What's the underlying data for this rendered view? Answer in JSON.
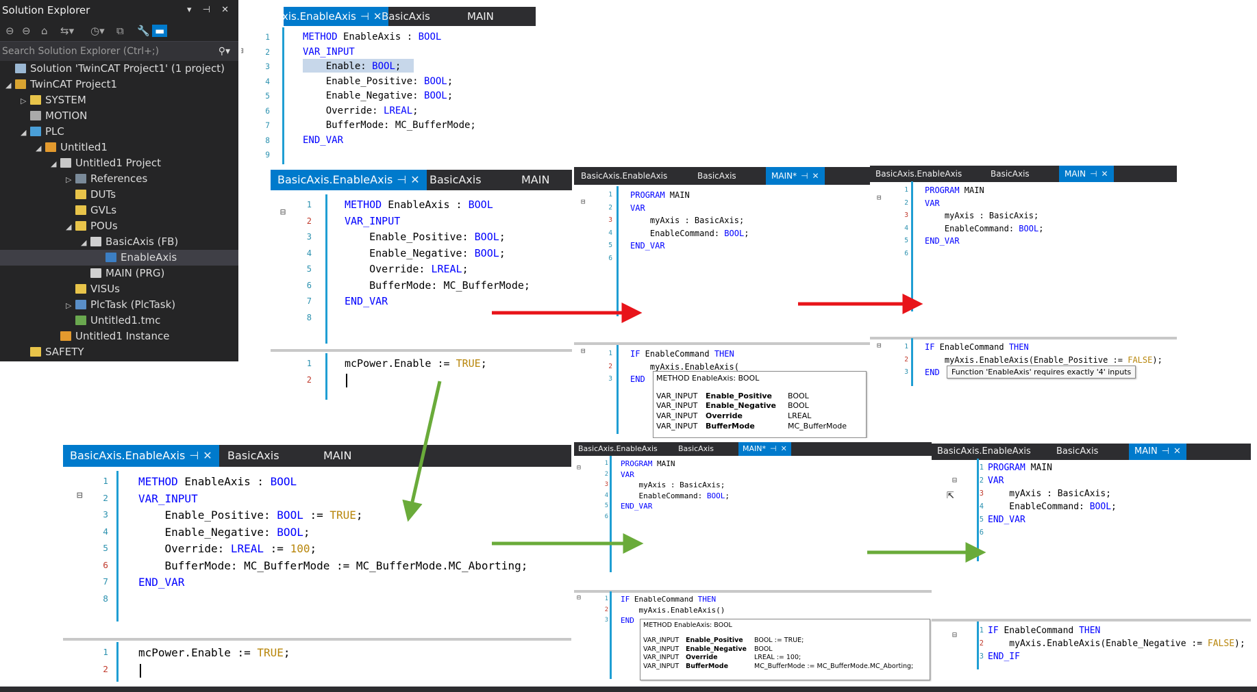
{
  "solution_explorer": {
    "title": "Solution Explorer",
    "header_controls": "▾ ⊣ ✕",
    "search_placeholder": "Search Solution Explorer (Ctrl+;)",
    "toolbar_icons": [
      "back-icon",
      "forward-icon",
      "home-icon",
      "sync-icon",
      "history-icon",
      "collapse-icon",
      "properties-icon",
      "preview-icon"
    ],
    "items": [
      {
        "label": "Solution 'TwinCAT Project1' (1 project)",
        "level": 0,
        "exp": "",
        "icon": "#9bb8d3"
      },
      {
        "label": "TwinCAT Project1",
        "level": 0,
        "exp": "◢",
        "icon": "#d9a431"
      },
      {
        "label": "SYSTEM",
        "level": 1,
        "exp": "▷",
        "icon": "#e8c44a"
      },
      {
        "label": "MOTION",
        "level": 1,
        "exp": "",
        "icon": "#aaaaaa"
      },
      {
        "label": "PLC",
        "level": 1,
        "exp": "◢",
        "icon": "#4a9fd8"
      },
      {
        "label": "Untitled1",
        "level": 2,
        "exp": "◢",
        "icon": "#e39a2e"
      },
      {
        "label": "Untitled1 Project",
        "level": 3,
        "exp": "◢",
        "icon": "#c8c8c8"
      },
      {
        "label": "References",
        "level": 4,
        "exp": "▷",
        "icon": "#7a8a99"
      },
      {
        "label": "DUTs",
        "level": 4,
        "exp": "",
        "icon": "#e8c44a"
      },
      {
        "label": "GVLs",
        "level": 4,
        "exp": "",
        "icon": "#e8c44a"
      },
      {
        "label": "POUs",
        "level": 4,
        "exp": "◢",
        "icon": "#e8c44a"
      },
      {
        "label": "BasicAxis (FB)",
        "level": 5,
        "exp": "◢",
        "icon": "#d0d0d0"
      },
      {
        "label": "EnableAxis",
        "level": 6,
        "exp": "",
        "icon": "#3c7fc4",
        "selected": true
      },
      {
        "label": "MAIN (PRG)",
        "level": 5,
        "exp": "",
        "icon": "#d0d0d0"
      },
      {
        "label": "VISUs",
        "level": 4,
        "exp": "",
        "icon": "#e8c44a"
      },
      {
        "label": "PlcTask (PlcTask)",
        "level": 4,
        "exp": "▷",
        "icon": "#5a8fc8"
      },
      {
        "label": "Untitled1.tmc",
        "level": 4,
        "exp": "",
        "icon": "#6aa84f"
      },
      {
        "label": "Untitled1 Instance",
        "level": 3,
        "exp": "",
        "icon": "#e39a2e"
      },
      {
        "label": "SAFETY",
        "level": 1,
        "exp": "",
        "icon": "#e8c44a"
      }
    ]
  },
  "tab_labels": {
    "method": "BasicAxis.EnableAxis",
    "fb": "BasicAxis",
    "main": "MAIN",
    "main_mod": "MAIN*",
    "pin": "⊣",
    "close": "✕"
  },
  "editors": [
    {
      "id": "e1",
      "lines_decl": [
        [
          [
            "kw",
            "METHOD"
          ],
          [
            "",
            " EnableAxis : "
          ],
          [
            "kw",
            "BOOL"
          ]
        ],
        [
          [
            "kw",
            "VAR_INPUT"
          ]
        ],
        [
          [
            "",
            "    Enable: "
          ],
          [
            "tp",
            "BOOL"
          ],
          [
            "",
            ";"
          ]
        ],
        [
          [
            "",
            "    Enable_Positive: "
          ],
          [
            "tp",
            "BOOL"
          ],
          [
            "",
            ";"
          ]
        ],
        [
          [
            "",
            "    Enable_Negative: "
          ],
          [
            "tp",
            "BOOL"
          ],
          [
            "",
            ";"
          ]
        ],
        [
          [
            "",
            "    Override: "
          ],
          [
            "tp",
            "LREAL"
          ],
          [
            "",
            ";"
          ]
        ],
        [
          [
            "",
            "    BufferMode: MC_BufferMode;"
          ]
        ],
        [
          [
            "kw",
            "END_VAR"
          ]
        ],
        []
      ]
    },
    {
      "id": "e2",
      "lines_decl": [
        [
          [
            "kw",
            "METHOD"
          ],
          [
            "",
            " EnableAxis : "
          ],
          [
            "kw",
            "BOOL"
          ]
        ],
        [
          [
            "kw",
            "VAR_INPUT"
          ]
        ],
        [
          [
            "",
            "    Enable_Positive: "
          ],
          [
            "tp",
            "BOOL"
          ],
          [
            "",
            ";"
          ]
        ],
        [
          [
            "",
            "    Enable_Negative: "
          ],
          [
            "tp",
            "BOOL"
          ],
          [
            "",
            ";"
          ]
        ],
        [
          [
            "",
            "    Override: "
          ],
          [
            "tp",
            "LREAL"
          ],
          [
            "",
            ";"
          ]
        ],
        [
          [
            "",
            "    BufferMode: MC_BufferMode;"
          ]
        ],
        [
          [
            "kw",
            "END_VAR"
          ]
        ],
        []
      ],
      "lines_impl": [
        [
          [
            "",
            "mcPower.Enable := "
          ],
          [
            "lit",
            "TRUE"
          ],
          [
            "",
            ";"
          ]
        ],
        []
      ]
    },
    {
      "id": "e3",
      "lines_decl": [
        [
          [
            "kw",
            "PROGRAM"
          ],
          [
            "",
            " MAIN"
          ]
        ],
        [
          [
            "kw",
            "VAR"
          ]
        ],
        [
          [
            "",
            "    myAxis : BasicAxis;"
          ]
        ],
        [
          [
            "",
            "    EnableCommand: "
          ],
          [
            "tp",
            "BOOL"
          ],
          [
            "",
            ";"
          ]
        ],
        [
          [
            "kw",
            "END_VAR"
          ]
        ],
        []
      ],
      "lines_impl": [
        [
          [
            "kw",
            "IF"
          ],
          [
            "",
            " EnableCommand "
          ],
          [
            "kw",
            "THEN"
          ]
        ],
        [
          [
            "",
            "    myAxis.EnableAxis("
          ]
        ],
        [
          [
            "kw",
            "END"
          ]
        ]
      ]
    },
    {
      "id": "e4",
      "lines_decl": [
        [
          [
            "kw",
            "PROGRAM"
          ],
          [
            "",
            " MAIN"
          ]
        ],
        [
          [
            "kw",
            "VAR"
          ]
        ],
        [
          [
            "",
            "    myAxis : BasicAxis;"
          ]
        ],
        [
          [
            "",
            "    EnableCommand: "
          ],
          [
            "tp",
            "BOOL"
          ],
          [
            "",
            ";"
          ]
        ],
        [
          [
            "kw",
            "END_VAR"
          ]
        ],
        []
      ],
      "lines_impl": [
        [
          [
            "kw",
            "IF"
          ],
          [
            "",
            " EnableCommand "
          ],
          [
            "kw",
            "THEN"
          ]
        ],
        [
          [
            "",
            "    myAxis.EnableAxis(Enable_Positive := "
          ],
          [
            "lit",
            "FALSE"
          ],
          [
            "",
            ");"
          ]
        ],
        [
          [
            "kw",
            "END"
          ]
        ]
      ]
    },
    {
      "id": "e5",
      "lines_decl": [
        [
          [
            "kw",
            "METHOD"
          ],
          [
            "",
            " EnableAxis : "
          ],
          [
            "kw",
            "BOOL"
          ]
        ],
        [
          [
            "kw",
            "VAR_INPUT"
          ]
        ],
        [
          [
            "",
            "    Enable_Positive: "
          ],
          [
            "tp",
            "BOOL"
          ],
          [
            "",
            " := "
          ],
          [
            "lit",
            "TRUE"
          ],
          [
            "",
            ";"
          ]
        ],
        [
          [
            "",
            "    Enable_Negative: "
          ],
          [
            "tp",
            "BOOL"
          ],
          [
            "",
            ";"
          ]
        ],
        [
          [
            "",
            "    Override: "
          ],
          [
            "tp",
            "LREAL"
          ],
          [
            "",
            " := "
          ],
          [
            "lit",
            "100"
          ],
          [
            "",
            ";"
          ]
        ],
        [
          [
            "",
            "    BufferMode: MC_BufferMode := MC_BufferMode.MC_Aborting;"
          ]
        ],
        [
          [
            "kw",
            "END_VAR"
          ]
        ],
        []
      ],
      "lines_impl": [
        [
          [
            "",
            "mcPower.Enable := "
          ],
          [
            "lit",
            "TRUE"
          ],
          [
            "",
            ";"
          ]
        ],
        []
      ]
    },
    {
      "id": "e6",
      "lines_decl": [
        [
          [
            "kw",
            "PROGRAM"
          ],
          [
            "",
            " MAIN"
          ]
        ],
        [
          [
            "kw",
            "VAR"
          ]
        ],
        [
          [
            "",
            "    myAxis : BasicAxis;"
          ]
        ],
        [
          [
            "",
            "    EnableCommand: "
          ],
          [
            "tp",
            "BOOL"
          ],
          [
            "",
            ";"
          ]
        ],
        [
          [
            "kw",
            "END_VAR"
          ]
        ],
        []
      ],
      "lines_impl": [
        [
          [
            "kw",
            "IF"
          ],
          [
            "",
            " EnableCommand "
          ],
          [
            "kw",
            "THEN"
          ]
        ],
        [
          [
            "",
            "    myAxis.EnableAxis()"
          ]
        ],
        [
          [
            "kw",
            "END"
          ]
        ]
      ]
    },
    {
      "id": "e7",
      "lines_decl": [
        [
          [
            "kw",
            "PROGRAM"
          ],
          [
            "",
            " MAIN"
          ]
        ],
        [
          [
            "kw",
            "VAR"
          ]
        ],
        [
          [
            "",
            "    myAxis : BasicAxis;"
          ]
        ],
        [
          [
            "",
            "    EnableCommand: "
          ],
          [
            "tp",
            "BOOL"
          ],
          [
            "",
            ";"
          ]
        ],
        [
          [
            "kw",
            "END_VAR"
          ]
        ],
        []
      ],
      "lines_impl": [
        [
          [
            "kw",
            "IF"
          ],
          [
            "",
            " EnableCommand "
          ],
          [
            "kw",
            "THEN"
          ]
        ],
        [
          [
            "",
            "    myAxis.EnableAxis(Enable_Negative := "
          ],
          [
            "lit",
            "FALSE"
          ],
          [
            "",
            ");"
          ]
        ],
        [
          [
            "kw",
            "END_IF"
          ]
        ]
      ]
    }
  ],
  "tooltips": {
    "e3": {
      "title": "METHOD EnableAxis: BOOL",
      "rows": [
        [
          "VAR_INPUT",
          "Enable_Positive",
          "BOOL"
        ],
        [
          "VAR_INPUT",
          "Enable_Negative",
          "BOOL"
        ],
        [
          "VAR_INPUT",
          "Override",
          "LREAL"
        ],
        [
          "VAR_INPUT",
          "BufferMode",
          "MC_BufferMode"
        ]
      ]
    },
    "e4": {
      "text": "Function 'EnableAxis' requires exactly '4' inputs"
    },
    "e6": {
      "title": "METHOD EnableAxis: BOOL",
      "rows": [
        [
          "VAR_INPUT",
          "Enable_Positive",
          "BOOL := TRUE;"
        ],
        [
          "VAR_INPUT",
          "Enable_Negative",
          "BOOL"
        ],
        [
          "VAR_INPUT",
          "Override",
          "LREAL := 100;"
        ],
        [
          "VAR_INPUT",
          "BufferMode",
          "MC_BufferMode := MC_BufferMode.MC_Aborting;"
        ]
      ]
    }
  },
  "colors": {
    "red_arrow": "#e8141a",
    "green_arrow": "#6aab3a",
    "accent": "#007acc"
  }
}
